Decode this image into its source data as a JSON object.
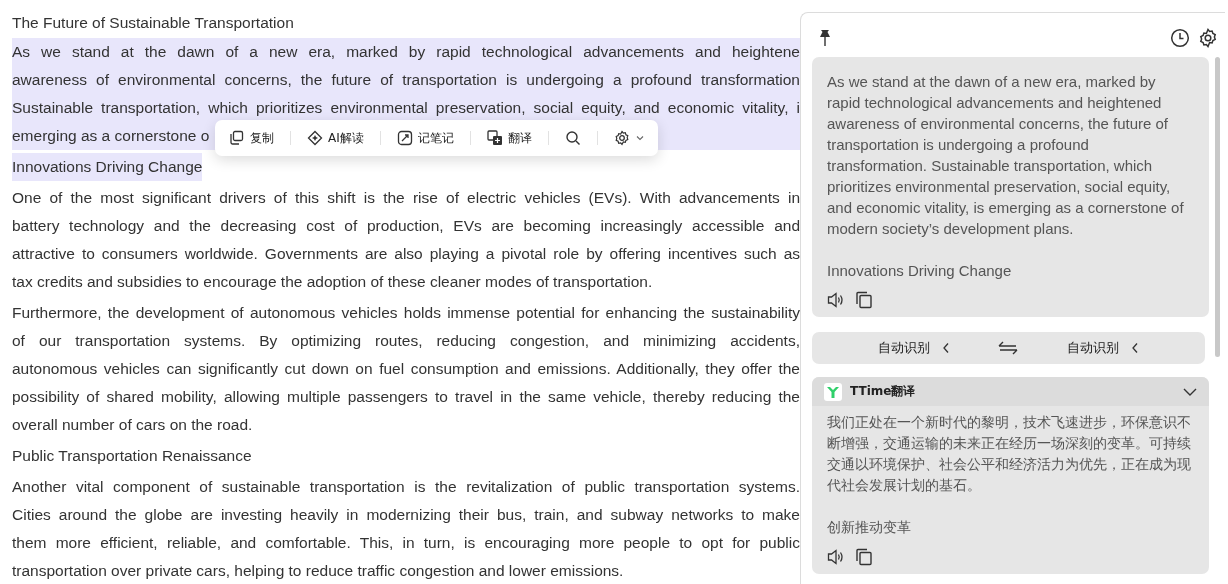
{
  "document": {
    "blocks": [
      {
        "kind": "heading",
        "highlighted": false,
        "lines": [
          "The Future of Sustainable Transportation"
        ]
      },
      {
        "kind": "paragraph",
        "highlighted": true,
        "lines": [
          "As we stand at the dawn of a new era, marked by rapid technological advancements and heightene",
          "awareness of environmental concerns, the future of transportation is undergoing a profound transformation",
          "Sustainable transportation, which prioritizes environmental preservation, social equity, and economic vitality, i",
          "emerging as a cornerstone o"
        ]
      },
      {
        "kind": "heading",
        "highlighted": true,
        "lines": [
          "Innovations Driving Change"
        ]
      },
      {
        "kind": "paragraph",
        "highlighted": false,
        "lines": [
          "One of the most significant drivers of this shift is the rise of electric vehicles (EVs). With advancements in",
          "battery technology and the decreasing cost of production, EVs are becoming increasingly accessible and",
          "attractive to consumers worldwide. Governments are also playing a pivotal role by offering incentives such as",
          "tax credits and subsidies to encourage the adoption of these cleaner modes of transportation."
        ]
      },
      {
        "kind": "paragraph",
        "highlighted": false,
        "lines": [
          "Furthermore, the development of autonomous vehicles holds immense potential for enhancing the sustainability",
          "of our transportation systems. By optimizing routes, reducing congestion, and minimizing accidents,",
          "autonomous vehicles can significantly cut down on fuel consumption and emissions. Additionally, they offer the",
          "possibility of shared mobility, allowing multiple passengers to travel in the same vehicle, thereby reducing the",
          "overall number of cars on the road."
        ]
      },
      {
        "kind": "heading",
        "highlighted": false,
        "lines": [
          "Public Transportation Renaissance"
        ]
      },
      {
        "kind": "paragraph",
        "highlighted": false,
        "lines": [
          "Another vital component of sustainable transportation is the revitalization of public transportation systems.",
          "Cities around the globe are investing heavily in modernizing their bus, train, and subway networks to make",
          "them more efficient, reliable, and comfortable. This, in turn, is encouraging more people to opt for public",
          "transportation over private cars, helping to reduce traffic congestion and lower emissions."
        ]
      }
    ]
  },
  "selection_toolbar": {
    "items": [
      {
        "kind": "copy",
        "label": "复制"
      },
      {
        "kind": "ai",
        "label": "AI解读"
      },
      {
        "kind": "note",
        "label": "记笔记"
      },
      {
        "kind": "translate",
        "label": "翻译"
      },
      {
        "kind": "search"
      },
      {
        "kind": "settings"
      }
    ]
  },
  "panel": {
    "source": {
      "text": "As we stand at the dawn of a new era, marked by rapid technological advancements and heightened awareness of environmental concerns, the future of transportation is undergoing a profound transformation. Sustainable transportation, which prioritizes environmental preservation, social equity, and economic vitality, is emerging as a cornerstone of modern society’s development plans.",
      "heading": "Innovations Driving Change"
    },
    "language_bar": {
      "source": "自动识别",
      "target": "自动识别"
    },
    "result": {
      "service": "TTime翻译",
      "expanded": true,
      "text": "我们正处在一个新时代的黎明，技术飞速进步，环保意识不断增强，交通运输的未来正在经历一场深刻的变革。可持续交通以环境保护、社会公平和经济活力为优先，正在成为现代社会发展计划的基石。",
      "heading": "创新推动变革"
    }
  }
}
